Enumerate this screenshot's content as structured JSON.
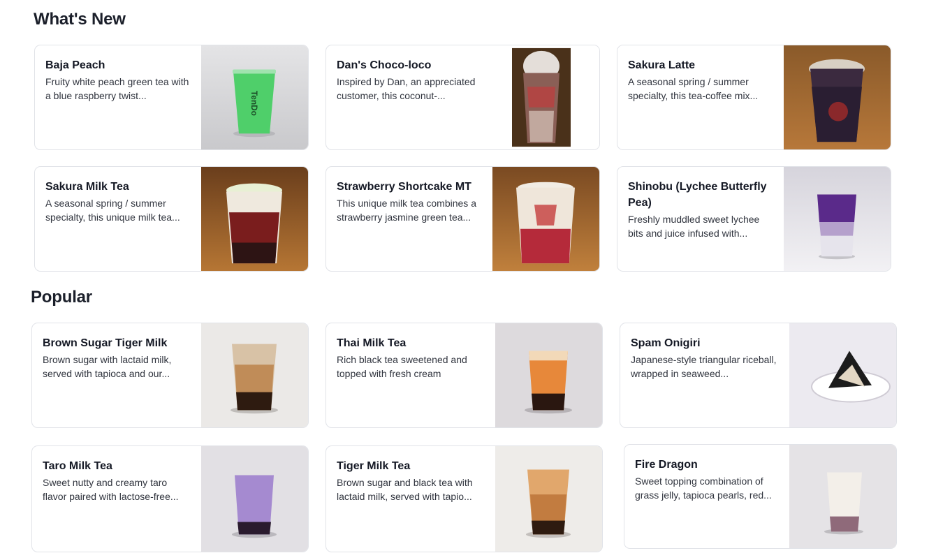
{
  "sections": {
    "whats_new": {
      "title": "What's New"
    },
    "popular": {
      "title": "Popular"
    }
  },
  "whats_new": [
    {
      "name": "Baja Peach",
      "description": "Fruity white peach green tea with a blue raspberry twist..."
    },
    {
      "name": "Dan's Choco-loco",
      "description": "Inspired by Dan, an appreciated customer, this coconut-..."
    },
    {
      "name": "Sakura Latte",
      "description": "A seasonal spring / summer specialty, this tea-coffee mix..."
    },
    {
      "name": "Sakura Milk Tea",
      "description": "A seasonal spring / summer specialty, this unique milk tea..."
    },
    {
      "name": "Strawberry Shortcake MT",
      "description": "This unique milk tea combines a strawberry jasmine green tea..."
    },
    {
      "name": "Shinobu (Lychee Butterfly Pea)",
      "description": "Freshly muddled sweet lychee bits and juice infused with..."
    }
  ],
  "popular": [
    {
      "name": "Brown Sugar Tiger Milk",
      "description": "Brown sugar with lactaid milk, served with tapioca and our..."
    },
    {
      "name": "Thai Milk Tea",
      "description": "Rich black tea sweetened and topped with fresh cream"
    },
    {
      "name": "Spam Onigiri",
      "description": "Japanese-style triangular riceball, wrapped in seaweed..."
    },
    {
      "name": "Taro Milk Tea",
      "description": "Sweet nutty and creamy taro flavor paired with lactose-free..."
    },
    {
      "name": "Tiger Milk Tea",
      "description": "Brown sugar and black tea with lactaid milk, served with tapio..."
    },
    {
      "name": "Fire Dragon",
      "description": "Sweet topping combination of grass jelly, tapioca pearls, red..."
    }
  ],
  "cup_logo_text": "TenDo",
  "colors": {
    "card_border": "#e1e3e8",
    "heading": "#1b1f2a",
    "body_text": "#30343e"
  }
}
